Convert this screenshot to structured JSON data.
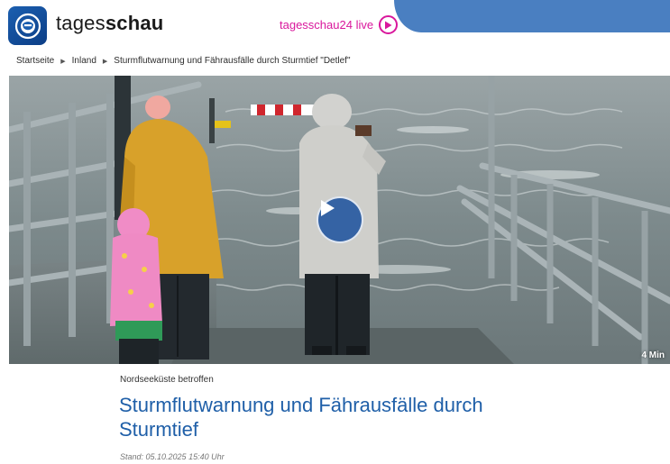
{
  "header": {
    "brand_light": "tages",
    "brand_bold": "schau",
    "live_label": "tagesschau24 live"
  },
  "breadcrumb": [
    {
      "label": "Startseite"
    },
    {
      "label": "Inland"
    },
    {
      "label": "Sturmflutwarnung und Fährausfälle durch Sturmtief \"Detlef\""
    }
  ],
  "hero": {
    "duration": "4 Min",
    "play_icon": "play-icon"
  },
  "article": {
    "kicker": "Nordseeküste betroffen",
    "headline": "Sturmflutwarnung und Fährausfälle durch Sturmtief",
    "stand": "Stand: 05.10.2025 15:40 Uhr"
  },
  "colors": {
    "brand_blue": "#1b5fb0",
    "live_magenta": "#d9179c",
    "headline_blue": "#1f5fa8",
    "header_band": "#4a7fc1"
  }
}
